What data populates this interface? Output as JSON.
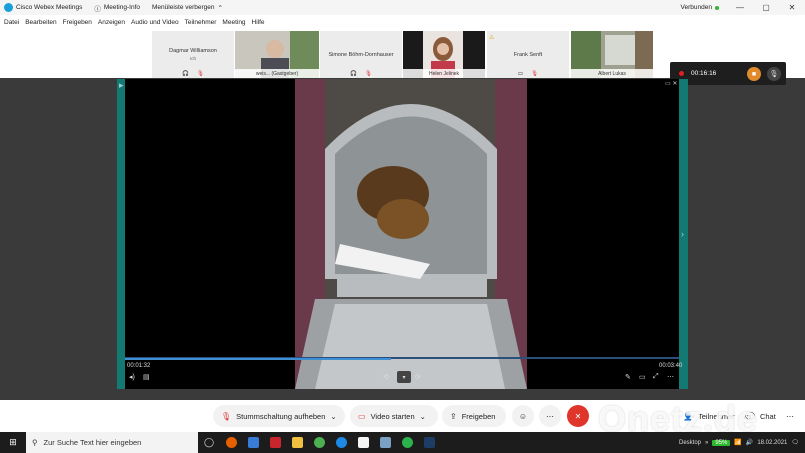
{
  "titlebar": {
    "app_title": "Cisco Webex Meetings",
    "meeting_info": "Meeting-Info",
    "menu_toggle": "Menüleiste verbergen",
    "status": "Verbunden"
  },
  "menubar": [
    "Datei",
    "Bearbeiten",
    "Freigeben",
    "Anzeigen",
    "Audio und Video",
    "Teilnehmer",
    "Meeting",
    "Hilfe"
  ],
  "participants": {
    "dagmar": {
      "name": "Dagmar Williamson",
      "sub": "Ich"
    },
    "weis": {
      "label": "weis...",
      "suffix": "(Gastgeber)"
    },
    "simone": {
      "name": "Simone Böhm-Dornhauser"
    },
    "helen": {
      "label": "Helen Jelinek"
    },
    "frank": {
      "name": "Frank Senft"
    },
    "albert": {
      "label": "Albert Lukas"
    }
  },
  "recording": {
    "time": "00:16:16"
  },
  "video": {
    "elapsed": "00:01:32",
    "total": "00:03:40",
    "progress": 0.48
  },
  "controls": {
    "mute": "Stummschaltung aufheben",
    "video": "Video starten",
    "share": "Freigeben",
    "participants": "Teilnehmer",
    "chat": "Chat"
  },
  "taskbar": {
    "search_placeholder": "Zur Suche Text hier eingeben",
    "desktop": "Desktop",
    "battery": "95%",
    "date": "18.02.2021"
  },
  "watermark": "Onetz.de",
  "colors": {
    "accent": "#127a72",
    "end_call": "#e0352b",
    "recording": "#e02020"
  }
}
